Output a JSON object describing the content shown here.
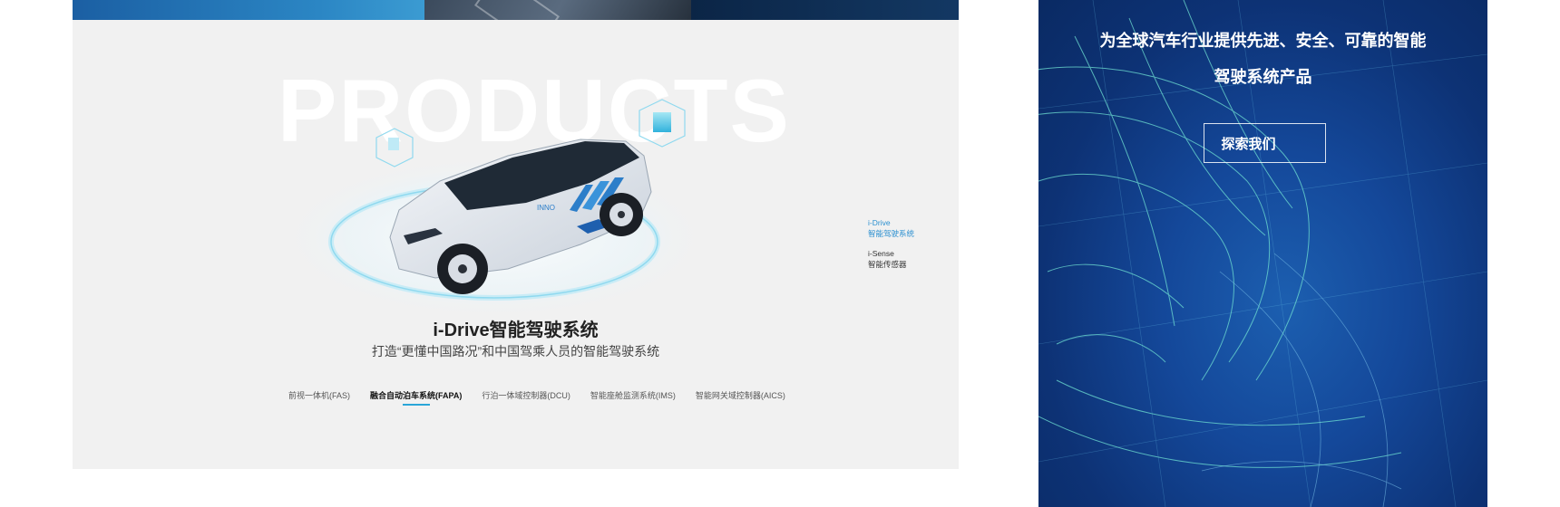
{
  "products": {
    "watermark": "PRODUCTS",
    "title": "i-Drive智能驾驶系统",
    "subtitle": "打造“更懂中国路况”和中国驾乘人员的智能驾驶系统",
    "side_nav": [
      {
        "name": "i-Drive",
        "desc": "智能驾驶系统",
        "active": true
      },
      {
        "name": "i-Sense",
        "desc": "智能传感器",
        "active": false
      }
    ],
    "tabs": [
      {
        "label": "前视一体机(FAS)",
        "active": false
      },
      {
        "label": "融合自动泊车系统(FAPA)",
        "active": true
      },
      {
        "label": "行泊一体域控制器(DCU)",
        "active": false
      },
      {
        "label": "智能座舱监测系统(IMS)",
        "active": false
      },
      {
        "label": "智能网关域控制器(AICS)",
        "active": false
      }
    ],
    "car_branding": "INNO"
  },
  "hero": {
    "line1": "为全球汽车行业提供先进、安全、可靠的智能",
    "line2": "驾驶系统产品",
    "button_label": "探索我们"
  },
  "colors": {
    "accent": "#2a8fd0",
    "tab_underline": "#2aa6d8",
    "panel_bg": "#f1f1f1",
    "hero_bg": "#14489a"
  }
}
